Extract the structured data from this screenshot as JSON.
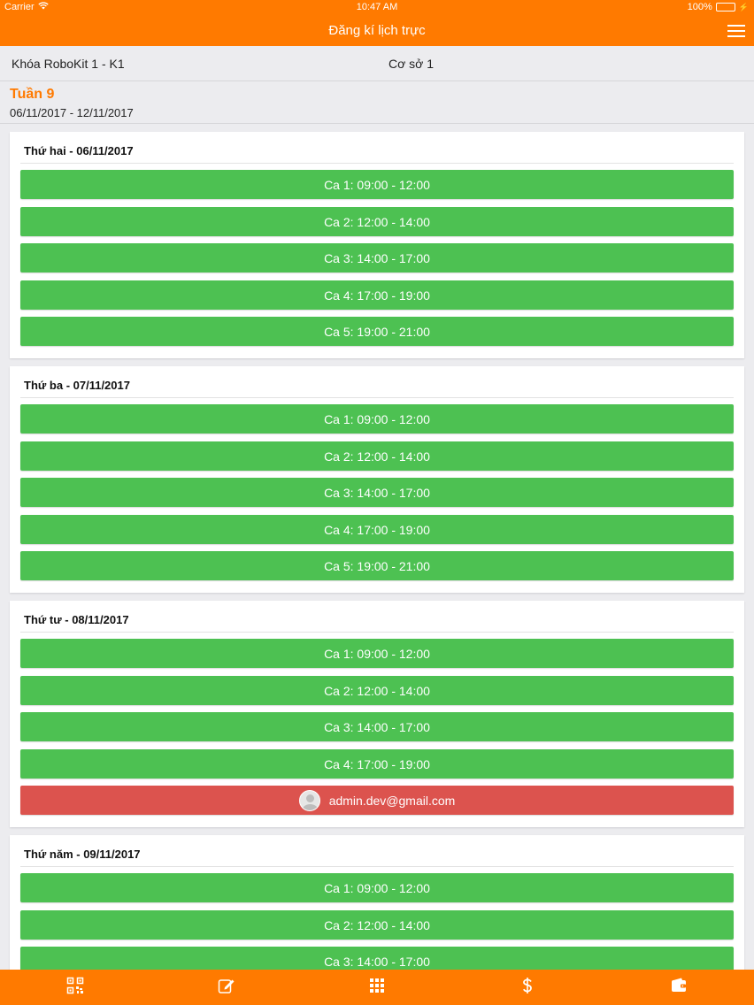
{
  "status_bar": {
    "carrier": "Carrier",
    "time": "10:47 AM",
    "battery": "100%"
  },
  "header": {
    "title": "Đăng kí lịch trực"
  },
  "filters": {
    "course": "Khóa RoboKit 1 - K1",
    "branch": "Cơ sở 1"
  },
  "week": {
    "label": "Tuần 9",
    "range": "06/11/2017 - 12/11/2017"
  },
  "days": [
    {
      "title": "Thứ hai - 06/11/2017",
      "shifts": [
        {
          "label": "Ca 1: 09:00 - 12:00",
          "state": "open"
        },
        {
          "label": "Ca 2: 12:00 - 14:00",
          "state": "open"
        },
        {
          "label": "Ca 3: 14:00 - 17:00",
          "state": "open"
        },
        {
          "label": "Ca 4: 17:00 - 19:00",
          "state": "open"
        },
        {
          "label": "Ca 5: 19:00 - 21:00",
          "state": "open"
        }
      ]
    },
    {
      "title": "Thứ ba - 07/11/2017",
      "shifts": [
        {
          "label": "Ca 1: 09:00 - 12:00",
          "state": "open"
        },
        {
          "label": "Ca 2: 12:00 - 14:00",
          "state": "open"
        },
        {
          "label": "Ca 3: 14:00 - 17:00",
          "state": "open"
        },
        {
          "label": "Ca 4: 17:00 - 19:00",
          "state": "open"
        },
        {
          "label": "Ca 5: 19:00 - 21:00",
          "state": "open"
        }
      ]
    },
    {
      "title": "Thứ tư - 08/11/2017",
      "shifts": [
        {
          "label": "Ca 1: 09:00 - 12:00",
          "state": "open"
        },
        {
          "label": "Ca 2: 12:00 - 14:00",
          "state": "open"
        },
        {
          "label": "Ca 3: 14:00 - 17:00",
          "state": "open"
        },
        {
          "label": "Ca 4: 17:00 - 19:00",
          "state": "open"
        },
        {
          "label": "admin.dev@gmail.com",
          "state": "taken"
        }
      ]
    },
    {
      "title": "Thứ năm - 09/11/2017",
      "shifts": [
        {
          "label": "Ca 1: 09:00 - 12:00",
          "state": "open"
        },
        {
          "label": "Ca 2: 12:00 - 14:00",
          "state": "open"
        },
        {
          "label": "Ca 3: 14:00 - 17:00",
          "state": "open"
        }
      ]
    }
  ],
  "tabbar": {
    "items": [
      {
        "icon": "qr-code-icon"
      },
      {
        "icon": "edit-icon"
      },
      {
        "icon": "grid-icon"
      },
      {
        "icon": "dollar-icon"
      },
      {
        "icon": "wallet-icon"
      }
    ]
  },
  "colors": {
    "brand": "#ff7a00",
    "open_shift": "#4dc152",
    "taken_shift": "#dc534e"
  }
}
